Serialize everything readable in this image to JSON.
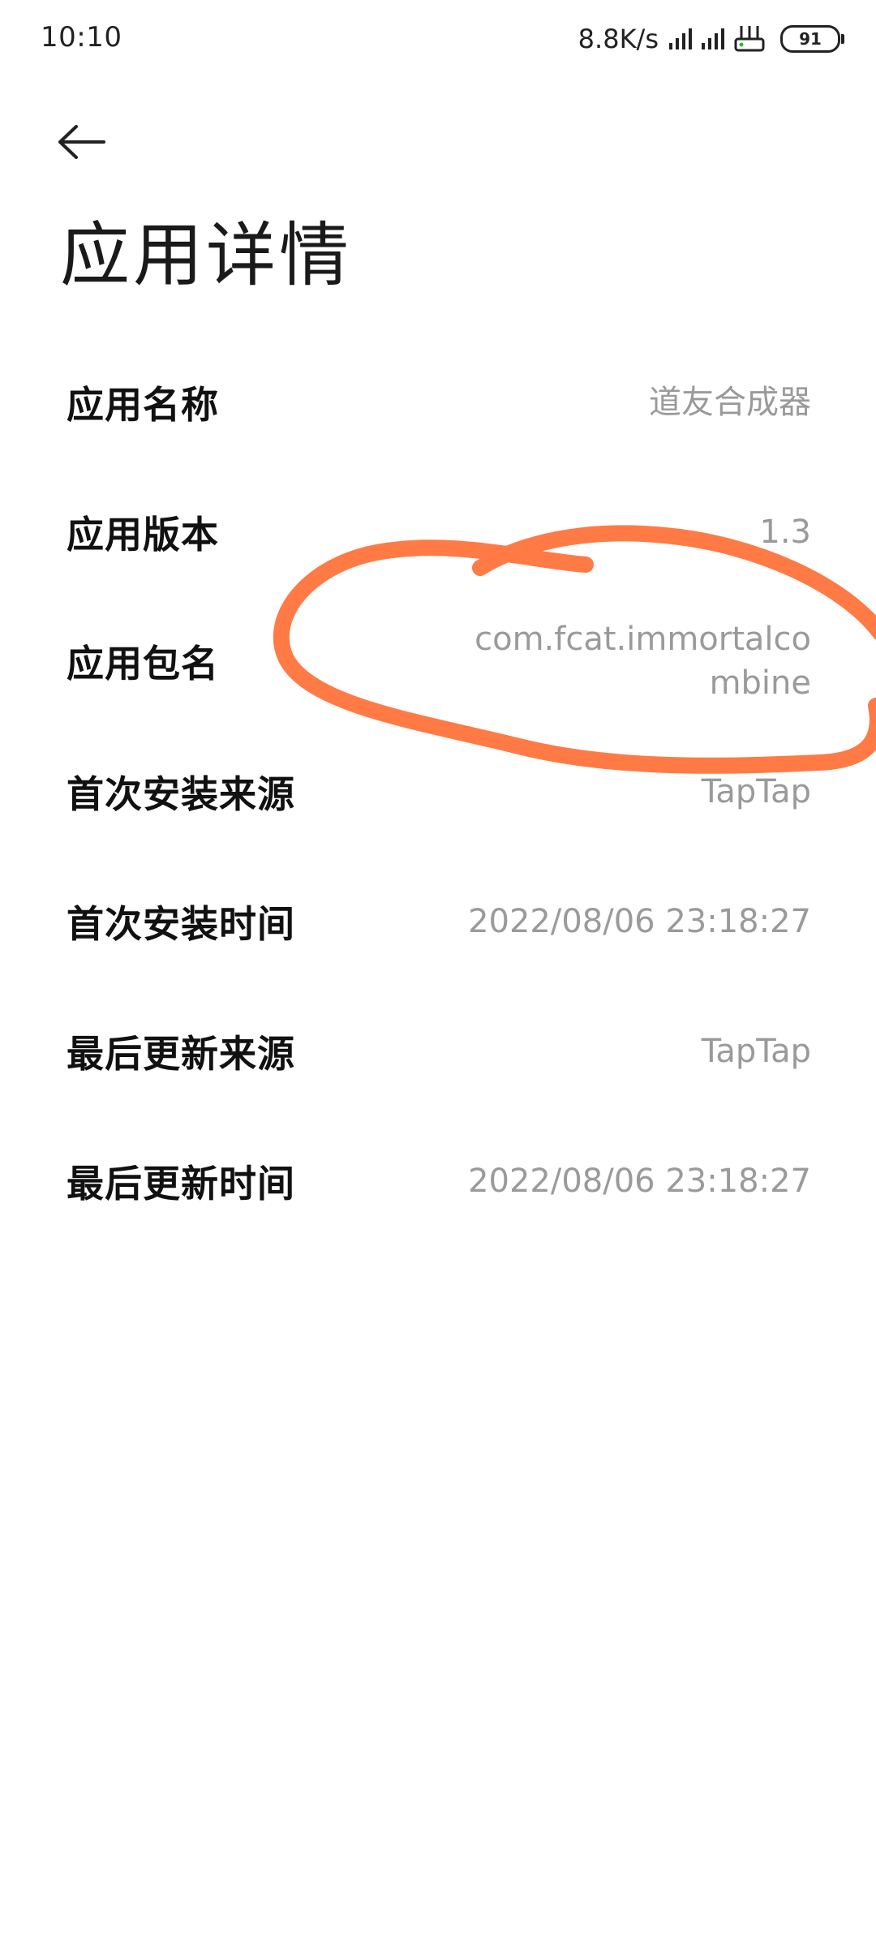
{
  "status_bar": {
    "time": "10:10",
    "net_speed": "8.8K/s",
    "battery": "91"
  },
  "header": {
    "title": "应用详情"
  },
  "details": [
    {
      "label": "应用名称",
      "value": "道友合成器"
    },
    {
      "label": "应用版本",
      "value": "1.3"
    },
    {
      "label": "应用包名",
      "value": "com.fcat.immortalcombine"
    },
    {
      "label": "首次安装来源",
      "value": "TapTap"
    },
    {
      "label": "首次安装时间",
      "value": "2022/08/06 23:18:27"
    },
    {
      "label": "最后更新来源",
      "value": "TapTap"
    },
    {
      "label": "最后更新时间",
      "value": "2022/08/06 23:18:27"
    }
  ],
  "colors": {
    "annotation": "#FF7A45",
    "value_text": "#9a9a9a"
  }
}
